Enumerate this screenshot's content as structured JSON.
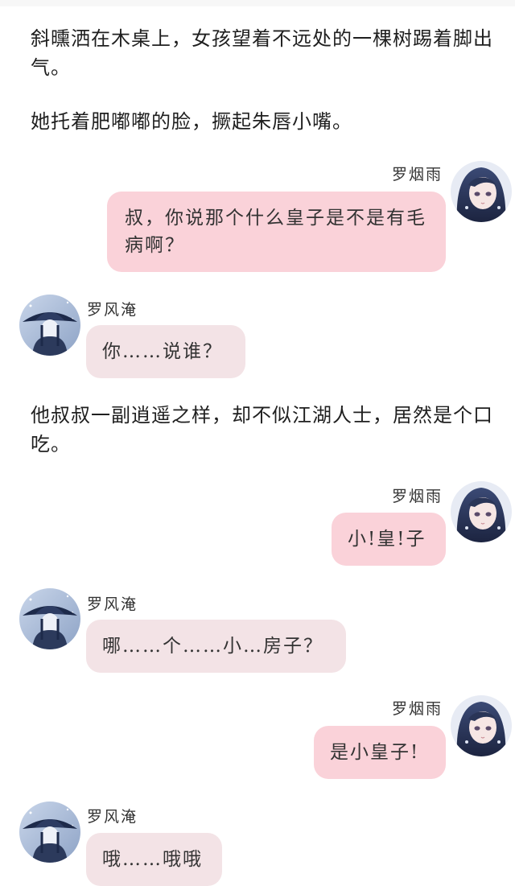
{
  "colors": {
    "bubble_self": "#fad2d9",
    "bubble_other": "#f3e3e6",
    "background": "#ffffff"
  },
  "narration": [
    "斜曛洒在木桌上，女孩望着不远处的一棵树踢着脚出气。",
    "她托着肥嘟嘟的脸，撅起朱唇小嘴。",
    "他叔叔一副逍遥之样，却不似江湖人士，居然是个口吃。"
  ],
  "speakers": {
    "self_name": "罗烟雨",
    "other_name": "罗风淹",
    "self_avatar_icon": "girl-portrait-avatar-icon",
    "other_avatar_icon": "hatted-figure-avatar-icon"
  },
  "messages": [
    {
      "speaker": "罗烟雨",
      "side": "right",
      "text": "叔，你说那个什么皇子是不是有毛病啊？"
    },
    {
      "speaker": "罗风淹",
      "side": "left",
      "text": "你……说谁？"
    },
    {
      "speaker": "罗烟雨",
      "side": "right",
      "text": "小!皇!子"
    },
    {
      "speaker": "罗风淹",
      "side": "left",
      "text": "哪……个……小…房子？"
    },
    {
      "speaker": "罗烟雨",
      "side": "right",
      "text": "是小皇子!"
    },
    {
      "speaker": "罗风淹",
      "side": "left",
      "text": "哦……哦哦"
    }
  ]
}
